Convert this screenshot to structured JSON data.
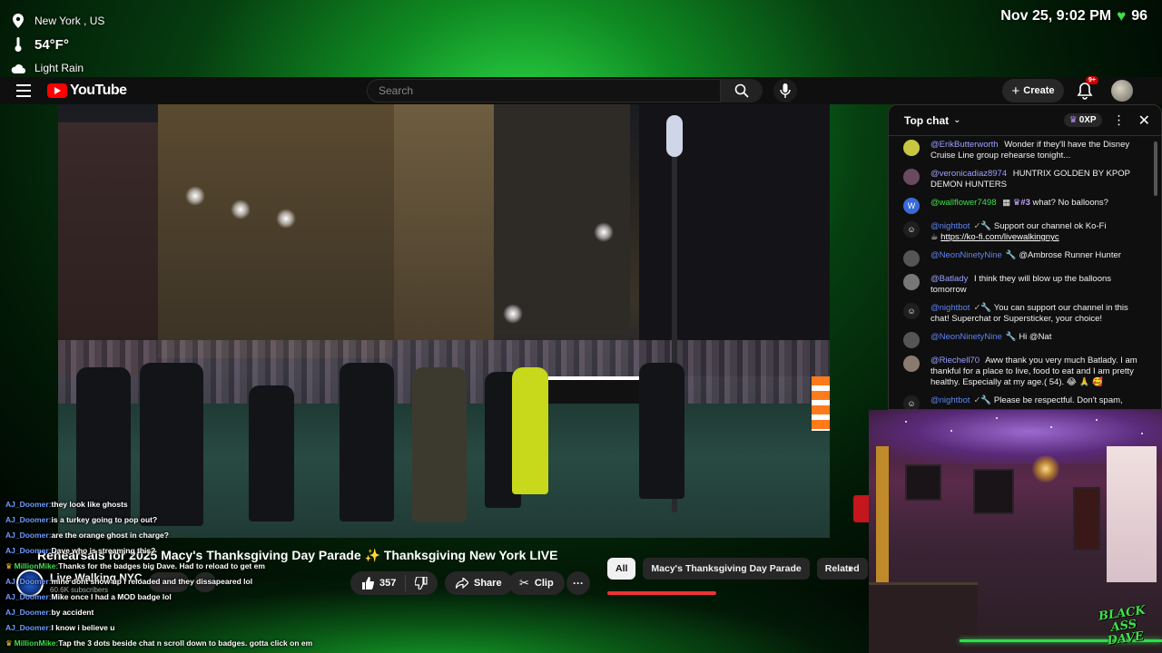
{
  "weather": {
    "location": "New York , US",
    "temperature": "54°F°",
    "condition": "Light Rain"
  },
  "status": {
    "datetime": "Nov 25, 9:02 PM",
    "battery": "96",
    "battery_color": "#3ee04a"
  },
  "youtube": {
    "brand": "YouTube",
    "search_placeholder": "Search",
    "create_label": "Create",
    "notifications_badge": "9+"
  },
  "chat": {
    "header_title": "Top chat",
    "xp_label": "0XP",
    "messages": [
      {
        "user": "@ErikButterworth",
        "text": "Wonder if they'll have the Disney Cruise Line group rehearse tonight..."
      },
      {
        "user": "@veronicadiaz8974",
        "text": "HUNTRIX GOLDEN BY KPOP DEMON HUNTERS"
      },
      {
        "user": "@wallflower7498",
        "rank": "#3",
        "text": "what? No balloons?",
        "avatar_letter": "W"
      },
      {
        "user": "@nightbot",
        "text": "Support our channel ok Ko-Fi",
        "link": "https://ko-fi.com/livewalkingnyc"
      },
      {
        "user": "@NeonNinetyNine",
        "text": "@Ambrose Runner Hunter"
      },
      {
        "user": "@Batlady",
        "text": "I think they will blow up the balloons tomorrow"
      },
      {
        "user": "@nightbot",
        "text": "You can support our channel in this chat! Superchat or Supersticker, your choice!"
      },
      {
        "user": "@NeonNinetyNine",
        "text": "Hi @Nat"
      },
      {
        "user": "@Riechell70",
        "text": "Aww thank you very much Batlady. I am thankful for a place to live, food to eat and I am pretty healthy. Especially at my age.( 54). 😂 🙏 🥰"
      },
      {
        "user": "@nightbot",
        "text": "Please be respectful. Don't spam,"
      }
    ]
  },
  "video": {
    "title": "Rehearsals for 2025 Macy's Thanksgiving Day Parade ✨ Thanksgiving New York LIVE",
    "channel_name": "Live Walking NYC",
    "subscribers": "60.6K subscribers",
    "likes": "357",
    "share_label": "Share",
    "clip_label": "Clip"
  },
  "chips": [
    "All",
    "Macy's Thanksgiving Day Parade",
    "Related"
  ],
  "overlay_chat": [
    {
      "user": "AJ_Doomer:",
      "text": "they look like ghosts"
    },
    {
      "user": "AJ_Doomer:",
      "text": "is a turkey going to pop out?"
    },
    {
      "user": "AJ_Doomer:",
      "text": "are the orange ghost in charge?"
    },
    {
      "user": "AJ_Doomer:",
      "text": "Dave who is streaming this?"
    },
    {
      "user": "MillionMike:",
      "text": "Thanks for the badges big Dave. Had to reload to get em",
      "crown": true
    },
    {
      "user": "AJ_Doomer:",
      "text": "mine dont show up i reloaded and they dissapeared lol"
    },
    {
      "user": "AJ_Doomer:",
      "text": "Mike once I had a MOD badge lol"
    },
    {
      "user": "AJ_Doomer:",
      "text": "by accident"
    },
    {
      "user": "AJ_Doomer:",
      "text": "I know i believe u"
    },
    {
      "user": "MillionMike:",
      "text": "Tap the 3 dots beside chat n scroll down to badges. gotta click on em",
      "crown": true
    }
  ],
  "cam_logo": {
    "line1": "BLACK",
    "line2": "ASS",
    "line3": "DAVE"
  }
}
